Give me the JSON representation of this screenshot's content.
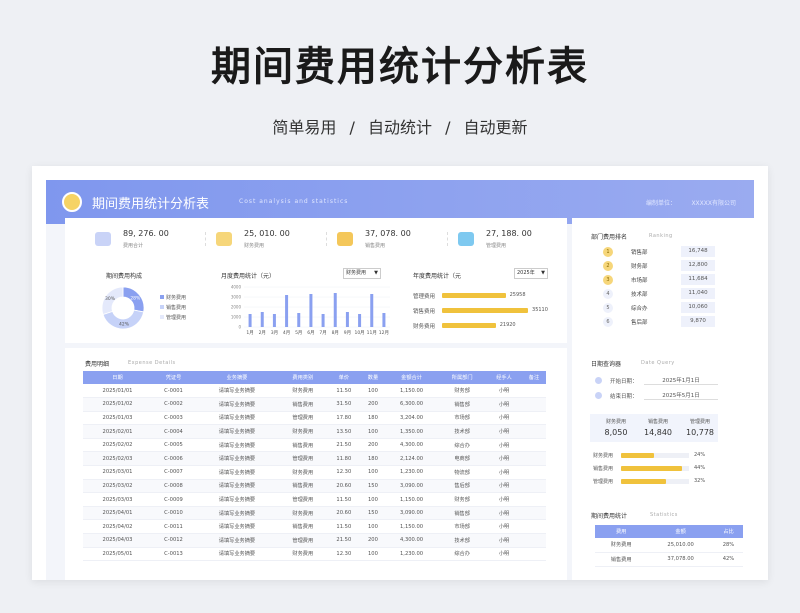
{
  "hero": {
    "title": "期间费用统计分析表",
    "subtitle": "简单易用 / 自动统计 / 自动更新"
  },
  "banner": {
    "title": "期间费用统计分析表",
    "en": "Cost analysis and statistics",
    "org_label": "编制单位：",
    "org_value": "XXXXX有限公司"
  },
  "kpis": [
    {
      "value": "89, 276. 00",
      "label": "费用合计",
      "color": "#c9d3f7"
    },
    {
      "value": "25, 010. 00",
      "label": "财务费用",
      "color": "#f6d67a"
    },
    {
      "value": "37, 078. 00",
      "label": "销售费用",
      "color": "#f4c75a"
    },
    {
      "value": "27, 188. 00",
      "label": "管理费用",
      "color": "#7ec9f0"
    }
  ],
  "donut": {
    "title": "期间费用构成",
    "legend": [
      "财务费用",
      "销售费用",
      "管理费用"
    ],
    "labels": [
      "28%",
      "42%",
      "30%"
    ]
  },
  "monthly": {
    "title": "月度费用统计（元）",
    "select": "财务费用",
    "yticks": [
      "4000",
      "3000",
      "2000",
      "1000",
      "0"
    ]
  },
  "annual": {
    "title": "年度费用统计（元",
    "select": "2025年",
    "rows": [
      {
        "label": "管理费用",
        "value": "25958"
      },
      {
        "label": "销售费用",
        "value": "35110"
      },
      {
        "label": "财务费用",
        "value": "21920"
      }
    ]
  },
  "chart_data": [
    {
      "type": "pie",
      "categories": [
        "财务费用",
        "销售费用",
        "管理费用"
      ],
      "values": [
        28,
        42,
        30
      ],
      "colors": [
        "#8aa0f0",
        "#c6d2f8",
        "#e4e9fb"
      ]
    },
    {
      "type": "bar",
      "title": "月度费用统计（元）",
      "categories": [
        "1月",
        "2月",
        "3月",
        "4月",
        "5月",
        "6月",
        "7月",
        "8月",
        "9月",
        "10月",
        "11月",
        "12月"
      ],
      "values": [
        1300,
        1500,
        1300,
        3200,
        1400,
        3300,
        1300,
        3400,
        1500,
        1300,
        3300,
        1400
      ],
      "ylim": [
        0,
        4000
      ]
    },
    {
      "type": "bar",
      "title": "年度费用统计（元",
      "categories": [
        "管理费用",
        "销售费用",
        "财务费用"
      ],
      "values": [
        25958,
        35110,
        21920
      ],
      "orientation": "horizontal"
    }
  ],
  "details": {
    "title": "费用明细",
    "en": "Expense Details",
    "headers": [
      "日期",
      "凭证号",
      "业务摘要",
      "费用类别",
      "单价",
      "数量",
      "金额合计",
      "所属部门",
      "经手人",
      "备注"
    ],
    "rows": [
      [
        "2025/01/01",
        "C-0001",
        "请填写业务摘要",
        "财务费用",
        "11.50",
        "100",
        "1,150.00",
        "财务部",
        "小明",
        ""
      ],
      [
        "2025/01/02",
        "C-0002",
        "请填写业务摘要",
        "销售费用",
        "31.50",
        "200",
        "6,300.00",
        "销售部",
        "小明",
        ""
      ],
      [
        "2025/01/03",
        "C-0003",
        "请填写业务摘要",
        "管理费用",
        "17.80",
        "180",
        "3,204.00",
        "市场部",
        "小明",
        ""
      ],
      [
        "2025/02/01",
        "C-0004",
        "请填写业务摘要",
        "财务费用",
        "13.50",
        "100",
        "1,350.00",
        "技术部",
        "小明",
        ""
      ],
      [
        "2025/02/02",
        "C-0005",
        "请填写业务摘要",
        "销售费用",
        "21.50",
        "200",
        "4,300.00",
        "综合办",
        "小明",
        ""
      ],
      [
        "2025/02/03",
        "C-0006",
        "请填写业务摘要",
        "管理费用",
        "11.80",
        "180",
        "2,124.00",
        "电商部",
        "小明",
        ""
      ],
      [
        "2025/03/01",
        "C-0007",
        "请填写业务摘要",
        "财务费用",
        "12.30",
        "100",
        "1,230.00",
        "物流部",
        "小明",
        ""
      ],
      [
        "2025/03/02",
        "C-0008",
        "请填写业务摘要",
        "销售费用",
        "20.60",
        "150",
        "3,090.00",
        "售后部",
        "小明",
        ""
      ],
      [
        "2025/03/03",
        "C-0009",
        "请填写业务摘要",
        "管理费用",
        "11.50",
        "100",
        "1,150.00",
        "财务部",
        "小明",
        ""
      ],
      [
        "2025/04/01",
        "C-0010",
        "请填写业务摘要",
        "财务费用",
        "20.60",
        "150",
        "3,090.00",
        "销售部",
        "小明",
        ""
      ],
      [
        "2025/04/02",
        "C-0011",
        "请填写业务摘要",
        "销售费用",
        "11.50",
        "100",
        "1,150.00",
        "市场部",
        "小明",
        ""
      ],
      [
        "2025/04/03",
        "C-0012",
        "请填写业务摘要",
        "管理费用",
        "21.50",
        "200",
        "4,300.00",
        "技术部",
        "小明",
        ""
      ],
      [
        "2025/05/01",
        "C-0013",
        "请填写业务摘要",
        "财务费用",
        "12.30",
        "100",
        "1,230.00",
        "综合办",
        "小明",
        ""
      ]
    ]
  },
  "ranking": {
    "title": "部门费用排名",
    "en": "Ranking",
    "rows": [
      {
        "rank": "1",
        "name": "销售部",
        "value": "16,748",
        "color": "#f6d67a"
      },
      {
        "rank": "2",
        "name": "财务部",
        "value": "12,800",
        "color": "#f6d67a"
      },
      {
        "rank": "3",
        "name": "市场部",
        "value": "11,684",
        "color": "#f6d67a"
      },
      {
        "rank": "4",
        "name": "技术部",
        "value": "11,040",
        "color": "#eef1fb"
      },
      {
        "rank": "5",
        "name": "综合办",
        "value": "10,060",
        "color": "#eef1fb"
      },
      {
        "rank": "6",
        "name": "售后部",
        "value": "9,870",
        "color": "#eef1fb"
      }
    ]
  },
  "query": {
    "title": "日期查询器",
    "en": "Date Query",
    "start_label": "开始日期：",
    "start_value": "2025年1月1日",
    "end_label": "结束日期：",
    "end_value": "2025年5月1日",
    "totals": [
      {
        "label": "财务费用",
        "value": "8,050"
      },
      {
        "label": "销售费用",
        "value": "14,840"
      },
      {
        "label": "管理费用",
        "value": "10,778"
      }
    ],
    "share": [
      {
        "label": "财务费用",
        "pct": "24%",
        "fraction": 0.24
      },
      {
        "label": "销售费用",
        "pct": "44%",
        "fraction": 0.44
      },
      {
        "label": "管理费用",
        "pct": "32%",
        "fraction": 0.32
      }
    ]
  },
  "stats": {
    "title": "期间费用统计",
    "en": "Statistics",
    "headers": [
      "费用",
      "金额",
      "占比"
    ],
    "rows": [
      [
        "财务费用",
        "25,010.00",
        "28%"
      ],
      [
        "销售费用",
        "37,078.00",
        "42%"
      ]
    ]
  }
}
